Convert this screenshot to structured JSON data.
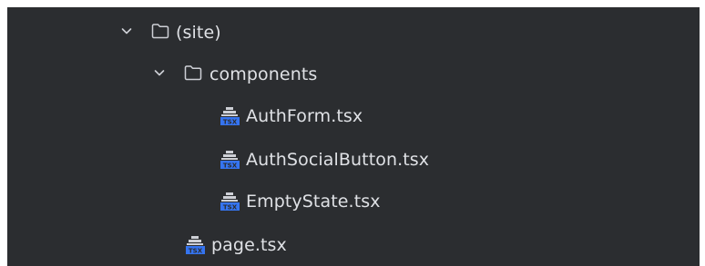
{
  "tree": {
    "items": [
      {
        "label": "(site)",
        "type": "folder",
        "expanded": true,
        "icon": "folder-icon",
        "chevron": "chevron-down-icon"
      },
      {
        "label": "components",
        "type": "folder",
        "expanded": true,
        "icon": "folder-icon",
        "chevron": "chevron-down-icon"
      },
      {
        "label": "AuthForm.tsx",
        "type": "file",
        "icon": "tsx-file-icon"
      },
      {
        "label": "AuthSocialButton.tsx",
        "type": "file",
        "icon": "tsx-file-icon"
      },
      {
        "label": "EmptyState.tsx",
        "type": "file",
        "icon": "tsx-file-icon"
      },
      {
        "label": "page.tsx",
        "type": "file",
        "icon": "tsx-file-icon"
      }
    ],
    "file_icon_badge": "TSX"
  },
  "colors": {
    "background": "#2b2d30",
    "text": "#dfe1e5",
    "icon_stroke": "#ced0d6",
    "tsx_badge": "#3574f0"
  }
}
